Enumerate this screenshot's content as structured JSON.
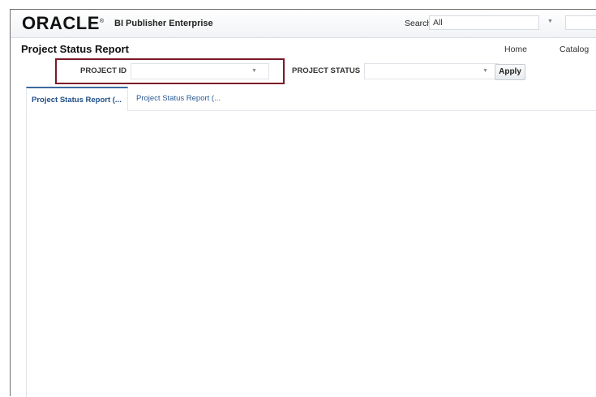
{
  "header": {
    "logo_text": "ORACLE",
    "logo_mark": "®",
    "product_name": "BI Publisher Enterprise",
    "search_label": "Search",
    "search_scope": "All"
  },
  "page": {
    "title": "Project Status Report",
    "nav": {
      "home": "Home",
      "catalog": "Catalog"
    }
  },
  "parameters": {
    "project_id_label": "PROJECT ID",
    "project_id_value": "",
    "project_status_label": "PROJECT STATUS",
    "project_status_value": "",
    "apply_label": "Apply"
  },
  "tabs": [
    {
      "label": "Project Status Report (...",
      "active": true
    },
    {
      "label": "Project Status Report (...",
      "active": false
    }
  ],
  "colors": {
    "highlight_border": "#7b1927",
    "active_tab_text": "#1f4e86",
    "inactive_tab_text": "#2a5a95"
  },
  "icons": {
    "dropdown": "chevron-down-icon"
  }
}
